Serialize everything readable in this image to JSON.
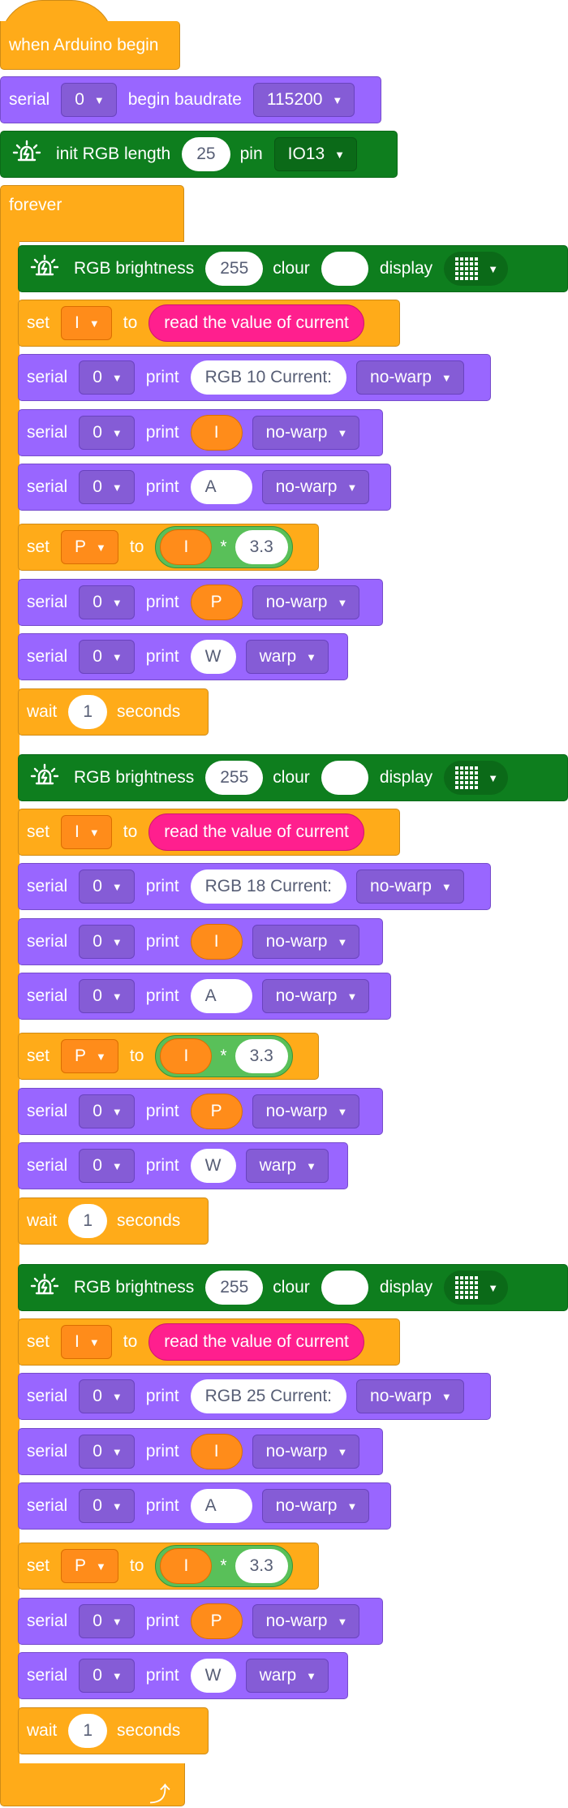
{
  "hat": {
    "label": "when Arduino begin"
  },
  "setup": [
    {
      "kind": "serial_begin",
      "serial": "serial",
      "port": "0",
      "mid": "begin baudrate",
      "baud": "115200"
    },
    {
      "kind": "rgb_init",
      "label": "init RGB length",
      "length": "25",
      "pin_label": "pin",
      "pin": "IO13"
    }
  ],
  "forever_label": "forever",
  "sections": [
    {
      "brightness_label": "RGB brightness",
      "brightness": "255",
      "colour_label": "clour",
      "display_label": "display",
      "set_label": "set",
      "var_current": "I",
      "to_label": "to",
      "read_label": "read the value of current",
      "serial_label": "serial",
      "port": "0",
      "print_label": "print",
      "print1": "RGB 10 Current:",
      "print1_mode": "no-warp",
      "print2": "I",
      "print2_mode": "no-warp",
      "print3": "A",
      "print3_mode": "no-warp",
      "var_power": "P",
      "mult_left": "I",
      "mult_op": "*",
      "mult_right": "3.3",
      "print4": "P",
      "print4_mode": "no-warp",
      "print5": "W",
      "print5_mode": "warp",
      "wait_label": "wait",
      "wait": "1",
      "seconds_label": "seconds"
    },
    {
      "brightness_label": "RGB brightness",
      "brightness": "255",
      "colour_label": "clour",
      "display_label": "display",
      "set_label": "set",
      "var_current": "I",
      "to_label": "to",
      "read_label": "read the value of current",
      "serial_label": "serial",
      "port": "0",
      "print_label": "print",
      "print1": "RGB 18 Current:",
      "print1_mode": "no-warp",
      "print2": "I",
      "print2_mode": "no-warp",
      "print3": "A",
      "print3_mode": "no-warp",
      "var_power": "P",
      "mult_left": "I",
      "mult_op": "*",
      "mult_right": "3.3",
      "print4": "P",
      "print4_mode": "no-warp",
      "print5": "W",
      "print5_mode": "warp",
      "wait_label": "wait",
      "wait": "1",
      "seconds_label": "seconds"
    },
    {
      "brightness_label": "RGB brightness",
      "brightness": "255",
      "colour_label": "clour",
      "display_label": "display",
      "set_label": "set",
      "var_current": "I",
      "to_label": "to",
      "read_label": "read the value of current",
      "serial_label": "serial",
      "port": "0",
      "print_label": "print",
      "print1": "RGB 25 Current:",
      "print1_mode": "no-warp",
      "print2": "I",
      "print2_mode": "no-warp",
      "print3": "A",
      "print3_mode": "no-warp",
      "var_power": "P",
      "mult_left": "I",
      "mult_op": "*",
      "mult_right": "3.3",
      "print4": "P",
      "print4_mode": "no-warp",
      "print5": "W",
      "print5_mode": "warp",
      "wait_label": "wait",
      "wait": "1",
      "seconds_label": "seconds"
    }
  ],
  "colors": {
    "purple": "#9966ff",
    "orange": "#ffab19",
    "green": "#0e7e1e",
    "pink": "#ff1f8e",
    "op_green": "#59c059"
  },
  "icons": {
    "bulb": "rgb-bulb-icon",
    "matrix": "led-matrix-icon",
    "caret": "dropdown-caret-icon",
    "loop": "loop-arrow-icon"
  }
}
